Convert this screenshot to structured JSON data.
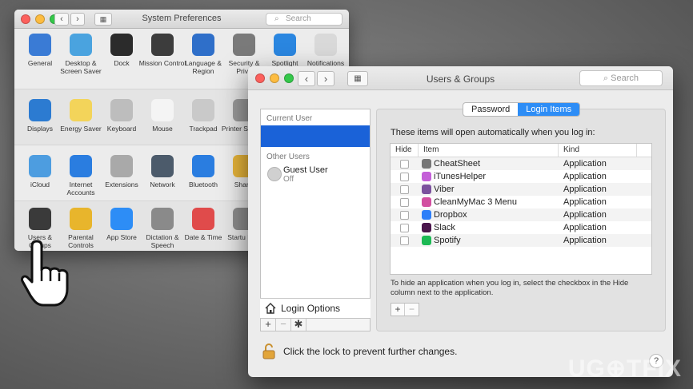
{
  "sysprefs": {
    "title": "System Preferences",
    "search_placeholder": "Search",
    "panes": [
      {
        "label": "General",
        "icon": "general-icon",
        "color": "#3a7bd5"
      },
      {
        "label": "Desktop & Screen Saver",
        "icon": "desktop-icon",
        "color": "#4aa3df"
      },
      {
        "label": "Dock",
        "icon": "dock-icon",
        "color": "#2b2b2b"
      },
      {
        "label": "Mission Control",
        "icon": "mission-control-icon",
        "color": "#3c3c3c"
      },
      {
        "label": "Language & Region",
        "icon": "language-icon",
        "color": "#2f6fc9"
      },
      {
        "label": "Security & Priva",
        "icon": "security-icon",
        "color": "#7a7a7a"
      },
      {
        "label": "Spotlight",
        "icon": "spotlight-icon",
        "color": "#2a86e0"
      },
      {
        "label": "Notifications",
        "icon": "notifications-icon",
        "color": "#d9d9d9"
      },
      {
        "label": "Displays",
        "icon": "displays-icon",
        "color": "#2c7bd1"
      },
      {
        "label": "Energy Saver",
        "icon": "energy-icon",
        "color": "#f3d45a"
      },
      {
        "label": "Keyboard",
        "icon": "keyboard-icon",
        "color": "#bdbdbd"
      },
      {
        "label": "Mouse",
        "icon": "mouse-icon",
        "color": "#f4f4f4"
      },
      {
        "label": "Trackpad",
        "icon": "trackpad-icon",
        "color": "#c9c9c9"
      },
      {
        "label": "Printer Scanne",
        "icon": "printer-icon",
        "color": "#9a9a9a"
      },
      {
        "label": "iCloud",
        "icon": "icloud-icon",
        "color": "#4d9de0"
      },
      {
        "label": "Internet Accounts",
        "icon": "internet-accounts-icon",
        "color": "#2a7de0"
      },
      {
        "label": "Extensions",
        "icon": "extensions-icon",
        "color": "#a9a9a9"
      },
      {
        "label": "Network",
        "icon": "network-icon",
        "color": "#4c5b6b"
      },
      {
        "label": "Bluetooth",
        "icon": "bluetooth-icon",
        "color": "#2a7de0"
      },
      {
        "label": "Sharin",
        "icon": "sharing-icon",
        "color": "#e6b43a"
      },
      {
        "label": "Users & Groups",
        "icon": "users-icon",
        "color": "#3a3a3a"
      },
      {
        "label": "Parental Controls",
        "icon": "parental-icon",
        "color": "#e8b52c"
      },
      {
        "label": "App Store",
        "icon": "appstore-icon",
        "color": "#2d8df6"
      },
      {
        "label": "Dictation & Speech",
        "icon": "microphone-icon",
        "color": "#8a8a8a"
      },
      {
        "label": "Date & Time",
        "icon": "calendar-icon",
        "color": "#e04b4b"
      },
      {
        "label": "Startu Disk",
        "icon": "disk-icon",
        "color": "#8c8c8c"
      }
    ]
  },
  "ug": {
    "title": "Users & Groups",
    "search_placeholder": "Search",
    "sidebar": {
      "current_user_header": "Current User",
      "other_users_header": "Other Users",
      "guest_name": "Guest User",
      "guest_status": "Off",
      "login_options": "Login Options"
    },
    "tabs": [
      "Password",
      "Login Items"
    ],
    "auto_message": "These items will open automatically when you log in:",
    "columns": {
      "hide": "Hide",
      "item": "Item",
      "kind": "Kind"
    },
    "items": [
      {
        "name": "CheatSheet",
        "kind": "Application",
        "icon": "cheatsheet-icon",
        "color": "#777777"
      },
      {
        "name": "iTunesHelper",
        "kind": "Application",
        "icon": "itunes-icon",
        "color": "#c45fd8"
      },
      {
        "name": "Viber",
        "kind": "Application",
        "icon": "viber-icon",
        "color": "#7b519d"
      },
      {
        "name": "CleanMyMac 3 Menu",
        "kind": "Application",
        "icon": "cleanmymac-icon",
        "color": "#d24fa0"
      },
      {
        "name": "Dropbox",
        "kind": "Application",
        "icon": "dropbox-icon",
        "color": "#2d7ff9"
      },
      {
        "name": "Slack",
        "kind": "Application",
        "icon": "slack-icon",
        "color": "#4a154b"
      },
      {
        "name": "Spotify",
        "kind": "Application",
        "icon": "spotify-icon",
        "color": "#1db954"
      }
    ],
    "hint": "To hide an application when you log in, select the checkbox in the Hide column next to the application.",
    "lock_text": "Click the lock to prevent further changes.",
    "help": "?"
  },
  "watermark": "UG⊕TFIX"
}
